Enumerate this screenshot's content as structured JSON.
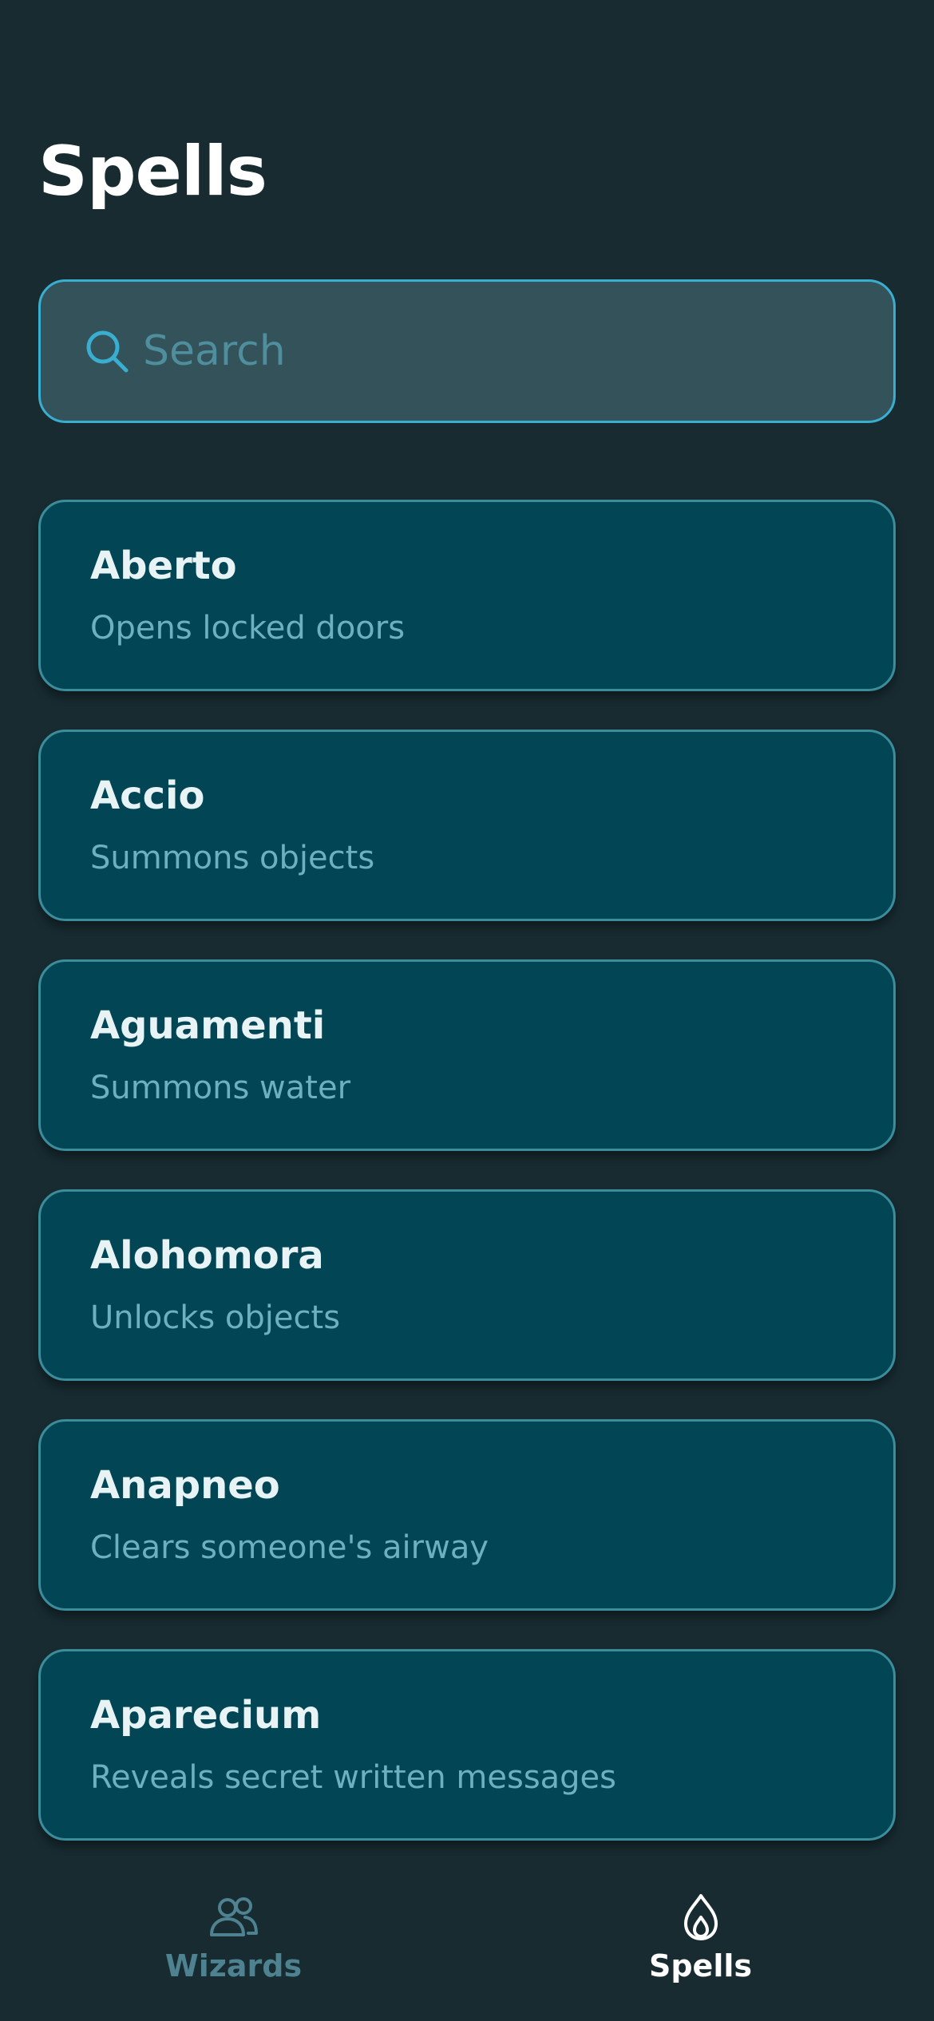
{
  "header": {
    "title": "Spells"
  },
  "search": {
    "placeholder": "Search",
    "value": ""
  },
  "spells": [
    {
      "name": "Aberto",
      "description": "Opens locked doors"
    },
    {
      "name": "Accio",
      "description": "Summons objects"
    },
    {
      "name": "Aguamenti",
      "description": "Summons water"
    },
    {
      "name": "Alohomora",
      "description": "Unlocks objects"
    },
    {
      "name": "Anapneo",
      "description": "Clears someone's airway"
    },
    {
      "name": "Aparecium",
      "description": "Reveals secret written messages"
    }
  ],
  "tabs": [
    {
      "label": "Wizards",
      "icon": "users-icon",
      "active": false
    },
    {
      "label": "Spells",
      "icon": "flame-icon",
      "active": true
    }
  ],
  "colors": {
    "background": "#172b31",
    "card": "#024655",
    "accent": "#3aaed0",
    "muted_text": "#6db0c0"
  }
}
